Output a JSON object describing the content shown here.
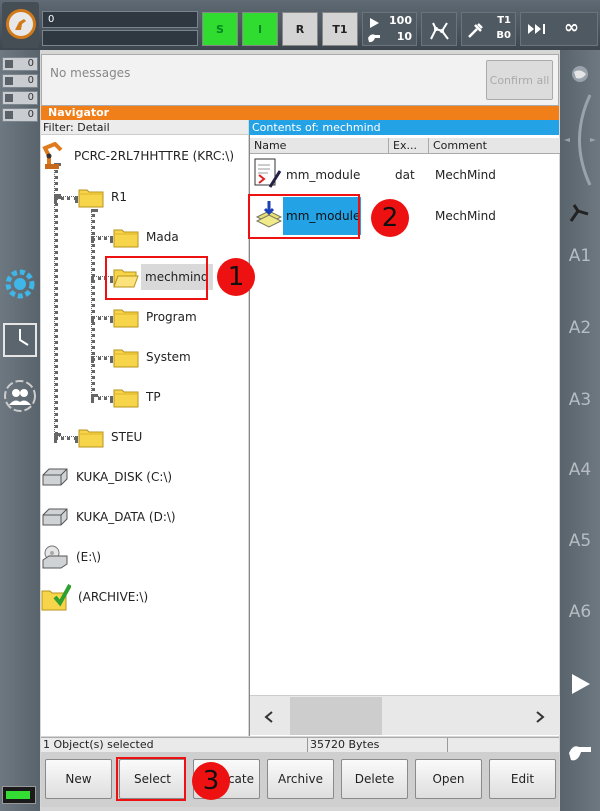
{
  "topbar": {
    "program_field": "0",
    "status_s": "S",
    "status_i": "I",
    "status_r": "R",
    "mode": "T1",
    "override_prog": "100",
    "override_jog": "10",
    "tool_label": "T1",
    "base_label": "B0",
    "increment": "∞"
  },
  "messages": {
    "counts": [
      "0",
      "0",
      "0",
      "0"
    ],
    "text": "No messages",
    "confirm_all": "Confirm all"
  },
  "navigator": {
    "title": "Navigator",
    "filter": "Filter: Detail",
    "tree": {
      "root": "PCRC-2RL7HHTTRE (KRC:\\)",
      "r1": "R1",
      "mada": "Mada",
      "mechmind": "mechmind",
      "program": "Program",
      "system": "System",
      "tp": "TP",
      "steu": "STEU",
      "kuka_disk": "KUKA_DISK (C:\\)",
      "kuka_data": "KUKA_DATA (D:\\)",
      "e_drive": "(E:\\)",
      "archive": "(ARCHIVE:\\)"
    },
    "contents_title": "Contents of: mechmind",
    "columns": {
      "name": "Name",
      "ext": "Ex...",
      "comment": "Comment"
    },
    "rows": [
      {
        "name": "mm_module",
        "ext": "dat",
        "comment": "MechMind"
      },
      {
        "name": "mm_module",
        "ext": "",
        "comment": "MechMind"
      }
    ]
  },
  "status": {
    "selected": "1 Object(s) selected",
    "bytes": "35720 Bytes"
  },
  "buttons": {
    "new": "New",
    "select": "Select",
    "duplicate": "cate",
    "archive": "Archive",
    "delete": "Delete",
    "open": "Open",
    "edit": "Edit"
  },
  "axes": [
    "A1",
    "A2",
    "A3",
    "A4",
    "A5",
    "A6"
  ],
  "annotations": {
    "one": "1",
    "two": "2",
    "three": "3"
  },
  "colors": {
    "accent": "#f07f1a",
    "selection": "#24a2e6",
    "highlight": "#e11111",
    "status_green": "#2fdc2f"
  }
}
